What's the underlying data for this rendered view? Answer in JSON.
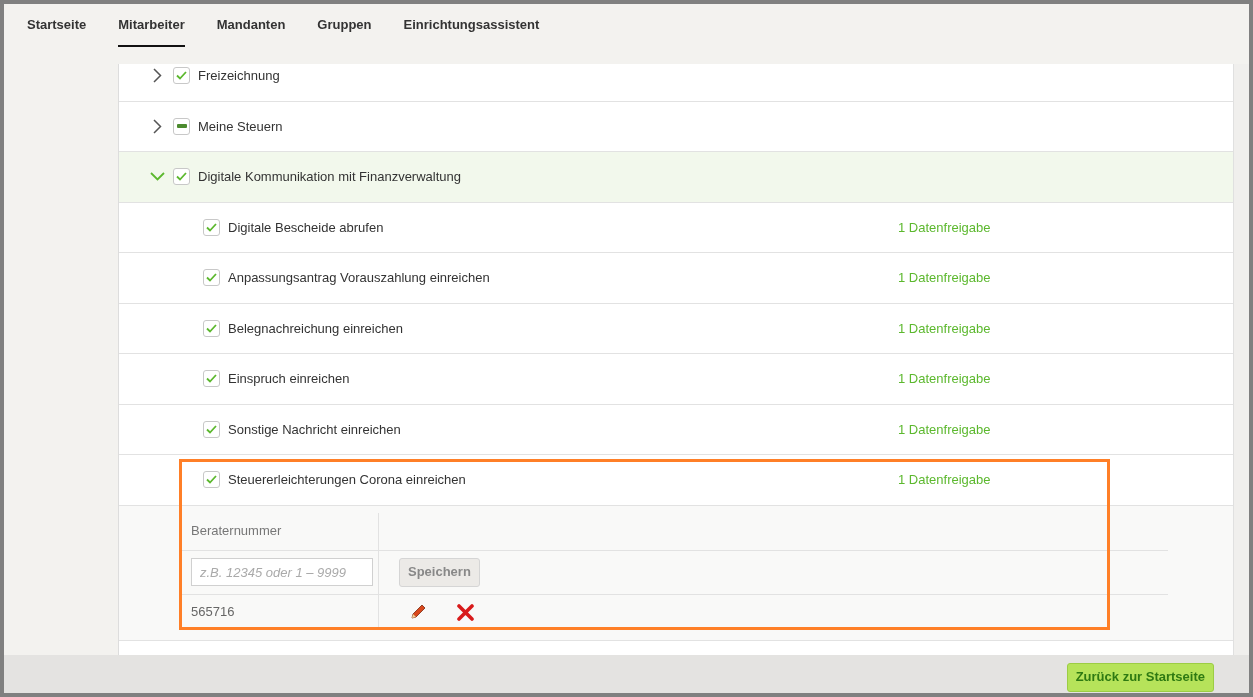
{
  "tabs": [
    {
      "label": "Startseite",
      "selected": false
    },
    {
      "label": "Mitarbeiter",
      "selected": true
    },
    {
      "label": "Mandanten",
      "selected": false
    },
    {
      "label": "Gruppen",
      "selected": false
    },
    {
      "label": "Einrichtungsassistent",
      "selected": false
    }
  ],
  "groups": [
    {
      "label": "Freizeichnung",
      "checked": true,
      "indeterminate": false,
      "expanded": false
    },
    {
      "label": "Meine Steuern",
      "indeterminate": true,
      "expanded": false
    },
    {
      "label": "Digitale Kommunikation mit Finanzverwaltung",
      "checked": true,
      "indeterminate": false,
      "expanded": true,
      "children": [
        {
          "label": "Digitale Bescheide abrufen",
          "checked": true,
          "share": "1 Datenfreigabe",
          "highlighted": false
        },
        {
          "label": "Anpassungsantrag Vorauszahlung einreichen",
          "checked": true,
          "share": "1 Datenfreigabe",
          "highlighted": false
        },
        {
          "label": "Belegnachreichung einreichen",
          "checked": true,
          "share": "1 Datenfreigabe",
          "highlighted": false
        },
        {
          "label": "Einspruch einreichen",
          "checked": true,
          "share": "1 Datenfreigabe",
          "highlighted": false
        },
        {
          "label": "Sonstige Nachricht einreichen",
          "checked": true,
          "share": "1 Datenfreigabe",
          "highlighted": false
        },
        {
          "label": "Steuererleichterungen Corona einreichen",
          "checked": true,
          "share": "1 Datenfreigabe",
          "highlighted": true,
          "detail": {
            "column": "Beraternummer",
            "placeholder": "z.B. 12345 oder 1 – 9999",
            "save": "Speichern",
            "entries": [
              "565716"
            ]
          }
        }
      ]
    }
  ],
  "footer": {
    "button": "Zurück zur Startseite"
  }
}
